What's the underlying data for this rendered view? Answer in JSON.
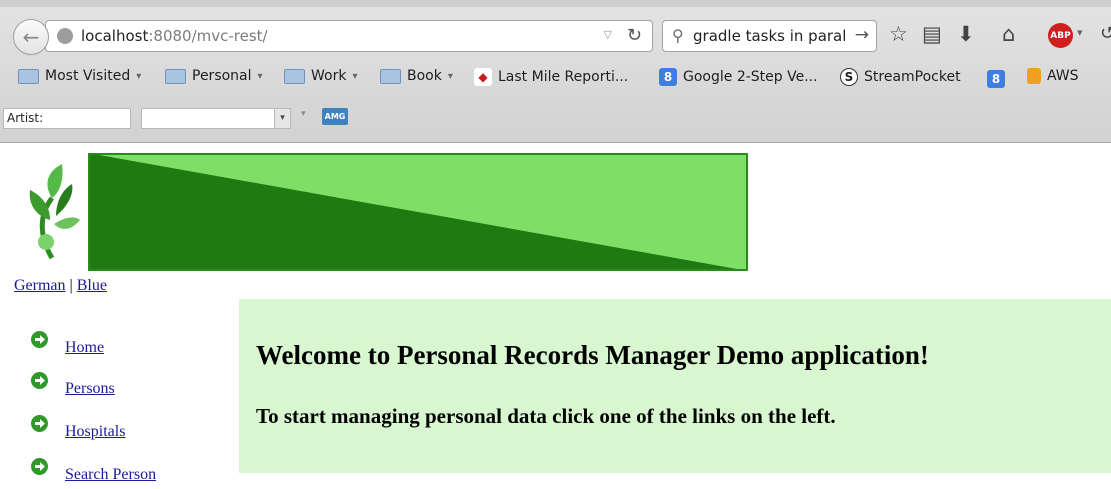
{
  "browser": {
    "url_host": "localhost",
    "url_path": ":8080/mvc-rest/",
    "search_value": "gradle tasks in paral",
    "bookmarks": [
      {
        "label": "Most Visited",
        "icon": "gear-folder-icon"
      },
      {
        "label": "Personal",
        "icon": "folder-icon"
      },
      {
        "label": "Work",
        "icon": "folder-icon"
      },
      {
        "label": "Book",
        "icon": "folder-icon"
      },
      {
        "label": "Last Mile Reporti...",
        "icon": "red-favicon"
      },
      {
        "label": "Google 2-Step Ve...",
        "icon": "google-favicon"
      },
      {
        "label": "StreamPocket",
        "icon": "s-favicon"
      },
      {
        "label": "AWS",
        "icon": "box-favicon"
      }
    ],
    "addon": {
      "artist_label": "Artist:",
      "amg_label": "AMG"
    },
    "abp_label": "ABP"
  },
  "page": {
    "lang_links": [
      "German",
      "Blue"
    ],
    "lang_separator": "|",
    "nav": [
      {
        "label": "Home"
      },
      {
        "label": "Persons"
      },
      {
        "label": "Hospitals"
      },
      {
        "label": "Search Person"
      }
    ],
    "welcome_title": "Welcome to Personal Records Manager Demo application!",
    "welcome_sub": "To start managing personal data click one of the links on the left."
  },
  "colors": {
    "panel_bg": "#d8f7d1",
    "banner_light": "#7ddf66",
    "banner_dark": "#1f7a12",
    "link": "#1a1a9a"
  }
}
